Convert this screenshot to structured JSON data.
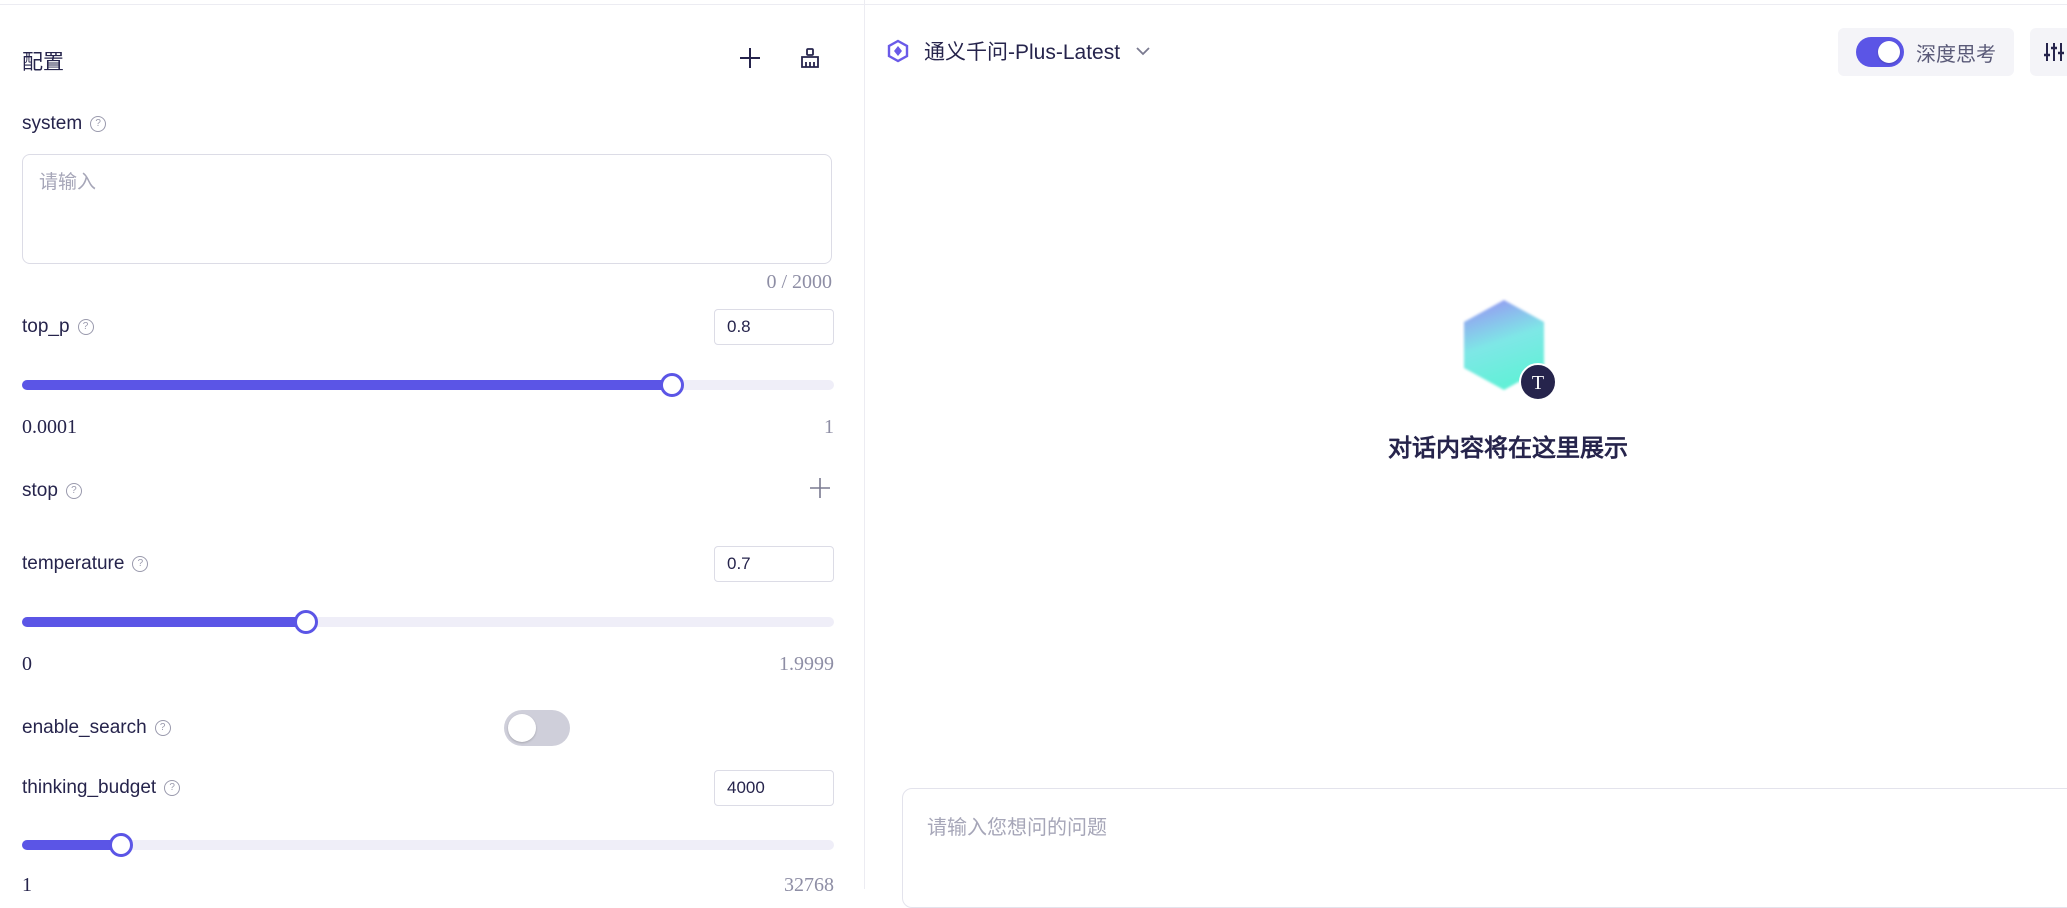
{
  "config": {
    "title": "配置",
    "add_icon": "plus-icon",
    "clear_icon": "broom-icon",
    "system": {
      "label": "system",
      "placeholder": "请输入",
      "counter": "0 / 2000"
    },
    "top_p": {
      "label": "top_p",
      "value": "0.8",
      "min": "0.0001",
      "max": "1",
      "fraction": 0.8
    },
    "stop": {
      "label": "stop",
      "add_icon": "plus-icon"
    },
    "temperature": {
      "label": "temperature",
      "value": "0.7",
      "min": "0",
      "max": "1.9999",
      "fraction": 0.35
    },
    "enable_search": {
      "label": "enable_search",
      "on": false
    },
    "thinking_budget": {
      "label": "thinking_budget",
      "value": "4000",
      "min": "1",
      "max": "32768",
      "fraction": 0.122
    }
  },
  "chat": {
    "model_name": "通义千问-Plus-Latest",
    "deep_thinking": {
      "label": "深度思考",
      "on": true
    },
    "empty_title": "对话内容将在这里展示",
    "input_placeholder": "请输入您想问的问题",
    "avatar_letter": "T"
  },
  "colors": {
    "accent": "#5b55e6",
    "text": "#26244c",
    "muted": "#8e8ea5"
  }
}
